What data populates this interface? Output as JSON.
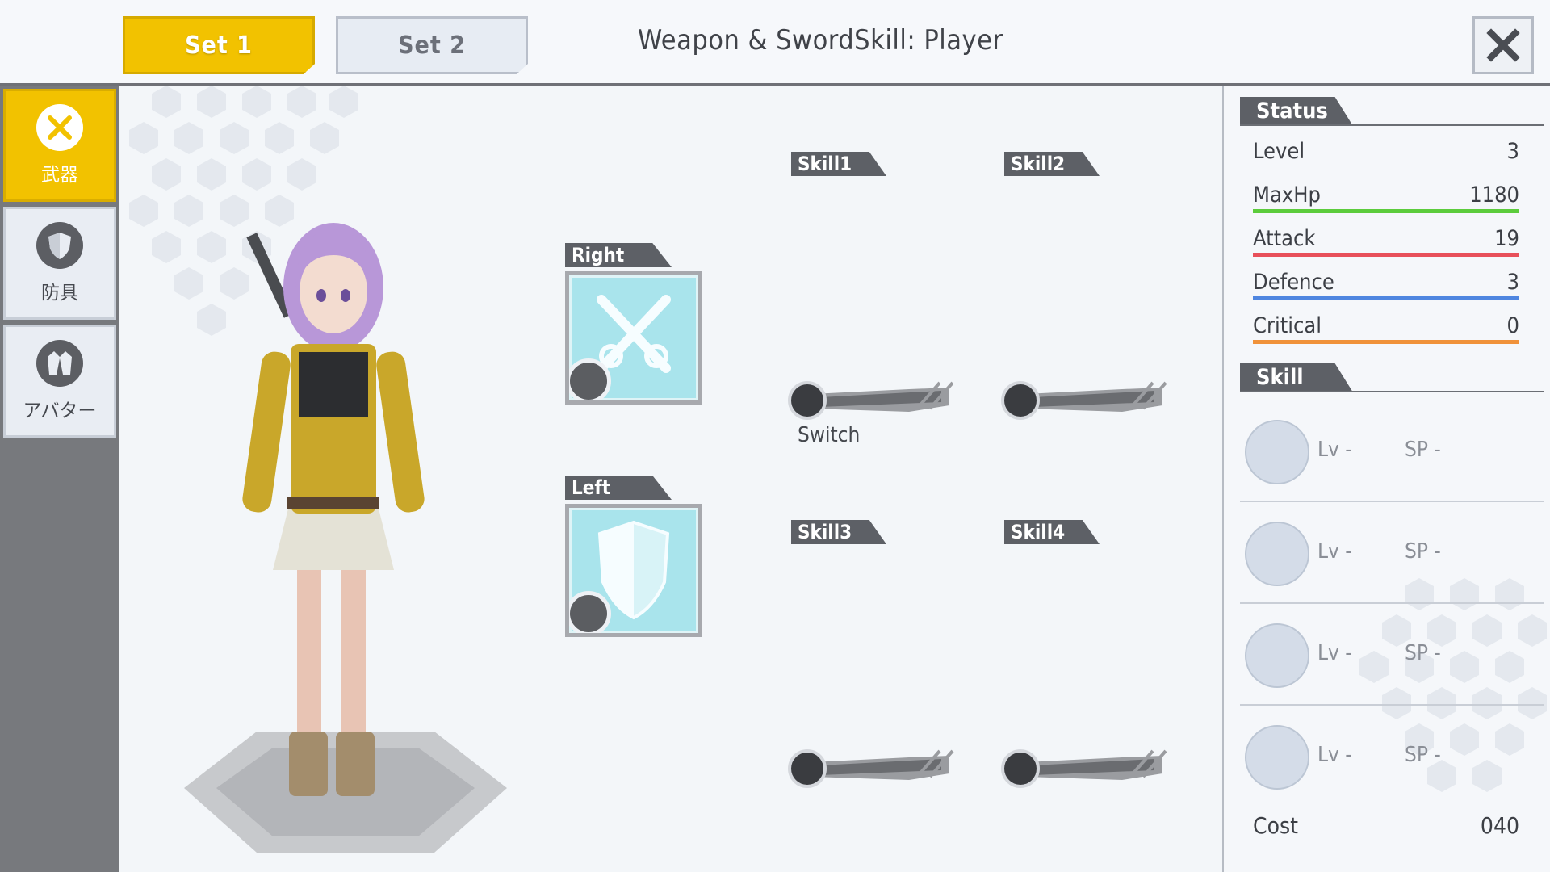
{
  "header": {
    "tabs": [
      {
        "label": "Set 1",
        "active": true
      },
      {
        "label": "Set 2",
        "active": false
      }
    ],
    "title": "Weapon & SwordSkill: Player",
    "close_icon": "close-icon"
  },
  "sidebar": {
    "items": [
      {
        "label": "武器",
        "icon": "crossed-swords-icon",
        "active": true
      },
      {
        "label": "防具",
        "icon": "shield-icon",
        "active": false
      },
      {
        "label": "アバター",
        "icon": "jacket-icon",
        "active": false
      }
    ]
  },
  "equipment": {
    "right_label": "Right",
    "left_label": "Left",
    "right_icon": "crossed-swords-icon",
    "left_icon": "shield-icon"
  },
  "skills_slots": {
    "skill1": "Skill1",
    "skill2": "Skill2",
    "skill3": "Skill3",
    "skill4": "Skill4",
    "switch_label": "Switch"
  },
  "status": {
    "heading": "Status",
    "rows": [
      {
        "name": "Level",
        "value": "3",
        "color": ""
      },
      {
        "name": "MaxHp",
        "value": "1180",
        "color": "#5ccc3c"
      },
      {
        "name": "Attack",
        "value": "19",
        "color": "#e8505a"
      },
      {
        "name": "Defence",
        "value": "3",
        "color": "#4f86e0"
      },
      {
        "name": "Critical",
        "value": "0",
        "color": "#f0923a"
      }
    ]
  },
  "skill_panel": {
    "heading": "Skill",
    "rows": [
      {
        "lv": "Lv -",
        "sp": "SP -"
      },
      {
        "lv": "Lv -",
        "sp": "SP -"
      },
      {
        "lv": "Lv -",
        "sp": "SP -"
      },
      {
        "lv": "Lv -",
        "sp": "SP -"
      }
    ],
    "cost_label": "Cost",
    "cost_value": "040"
  },
  "colors": {
    "accent": "#f2c200",
    "dark": "#5d6066",
    "card": "#a9e4ec"
  }
}
